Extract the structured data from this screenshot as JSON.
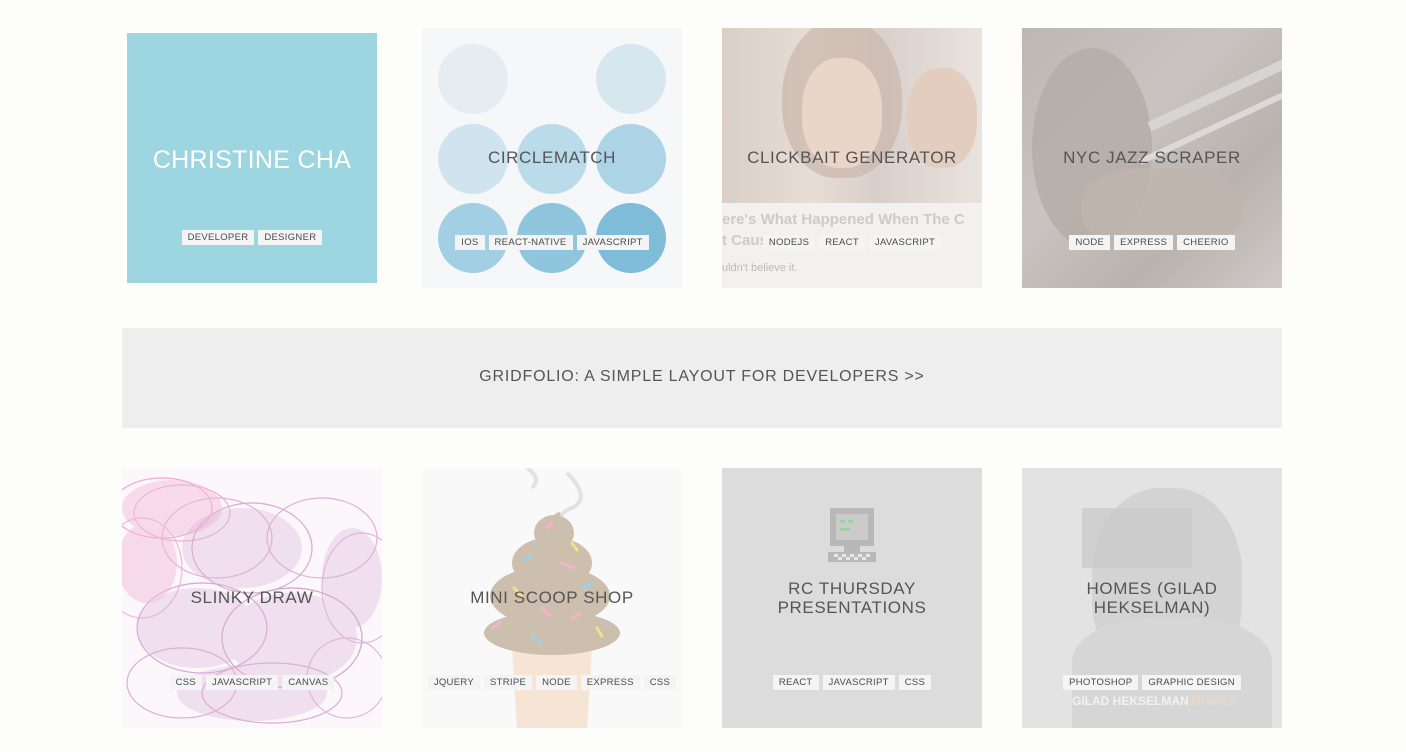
{
  "tiles": [
    {
      "title": "CHRISTINE CHA",
      "tags": [
        "DEVELOPER",
        "DESIGNER"
      ]
    },
    {
      "title": "CIRCLEMATCH",
      "tags": [
        "IOS",
        "REACT-NATIVE",
        "JAVASCRIPT"
      ]
    },
    {
      "title": "CLICKBAIT GENERATOR",
      "tags": [
        "NODEJS",
        "REACT",
        "JAVASCRIPT"
      ],
      "background_text": [
        "ere's What Happened When The C",
        "t Caus",
        "uldn't believe it."
      ]
    },
    {
      "title": "NYC JAZZ SCRAPER",
      "tags": [
        "NODE",
        "EXPRESS",
        "CHEERIO"
      ]
    },
    {
      "title": "SLINKY DRAW",
      "tags": [
        "CSS",
        "JAVASCRIPT",
        "CANVAS"
      ]
    },
    {
      "title": "MINI SCOOP SHOP",
      "tags": [
        "JQUERY",
        "STRIPE",
        "NODE",
        "EXPRESS",
        "CSS"
      ]
    },
    {
      "title_lines": [
        "RC THURSDAY",
        "PRESENTATIONS"
      ],
      "tags": [
        "REACT",
        "JAVASCRIPT",
        "CSS"
      ]
    },
    {
      "title_lines": [
        "HOMES (GILAD",
        "HEKSELMAN)"
      ],
      "tags": [
        "PHOTOSHOP",
        "GRAPHIC DESIGN"
      ],
      "background_text": [
        "GILAD HEKSELMAN",
        "HOMES"
      ]
    }
  ],
  "banner": {
    "label": "GRIDFOLIO: A SIMPLE LAYOUT FOR DEVELOPERS >>"
  },
  "colors": {
    "intro_tile": "#9dd5e0",
    "banner_bg": "#eeeeef",
    "tag_bg": "#f4f4f4",
    "title_text": "#555555"
  }
}
